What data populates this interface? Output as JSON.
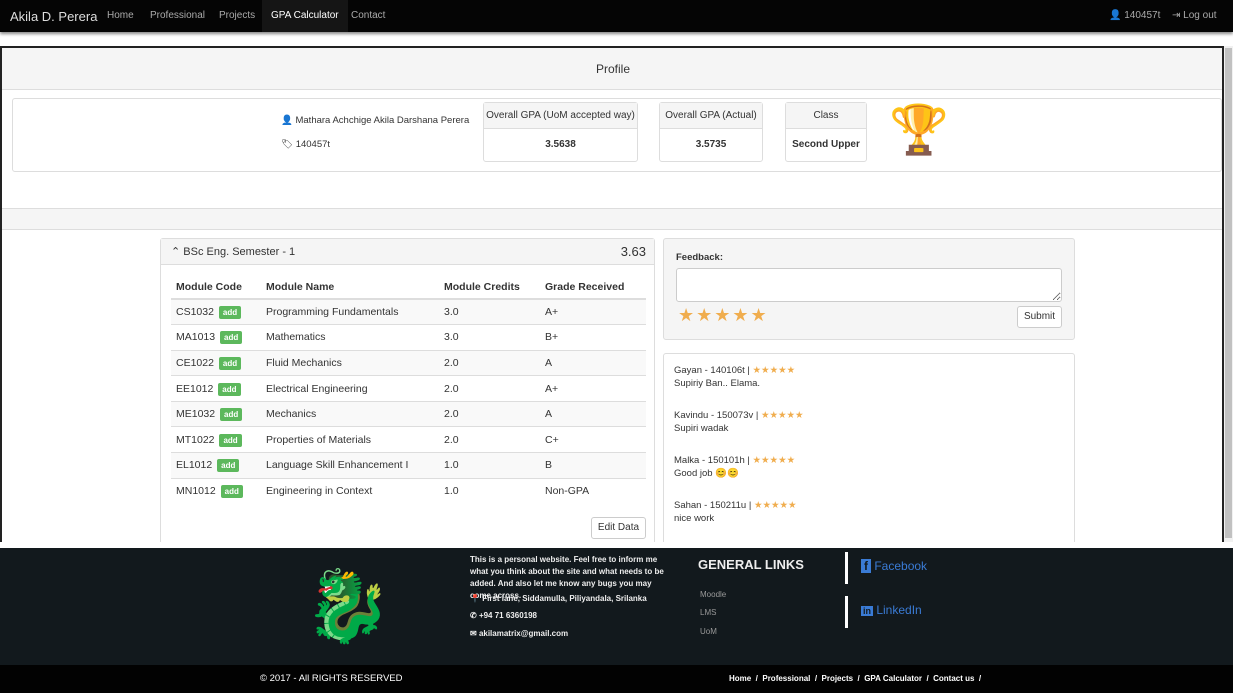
{
  "nav": {
    "brand": "Akila D. Perera",
    "items": [
      "Home",
      "Professional",
      "Projects",
      "GPA Calculator",
      "Contact"
    ],
    "user": "140457t",
    "logout": "Log out"
  },
  "profile": {
    "title": "Profile",
    "name": "Mathara Achchige Akila Darshana Perera",
    "id": "140457t",
    "stats": [
      {
        "label": "Overall GPA (UoM accepted way)",
        "value": "3.5638"
      },
      {
        "label": "Overall GPA (Actual)",
        "value": "3.5735"
      },
      {
        "label": "Class",
        "value": "Second Upper"
      }
    ]
  },
  "semester": {
    "title": "BSc Eng. Semester - 1",
    "gpa": "3.63",
    "headers": [
      "Module Code",
      "Module Name",
      "Module Credits",
      "Grade Received"
    ],
    "add_label": "add",
    "edit_label": "Edit Data",
    "rows": [
      [
        "CS1032",
        "Programming Fundamentals",
        "3.0",
        "A+"
      ],
      [
        "MA1013",
        "Mathematics",
        "3.0",
        "B+"
      ],
      [
        "CE1022",
        "Fluid Mechanics",
        "2.0",
        "A"
      ],
      [
        "EE1012",
        "Electrical Engineering",
        "2.0",
        "A+"
      ],
      [
        "ME1032",
        "Mechanics",
        "2.0",
        "A"
      ],
      [
        "MT1022",
        "Properties of Materials",
        "2.0",
        "C+"
      ],
      [
        "EL1012",
        "Language Skill Enhancement I",
        "1.0",
        "B"
      ],
      [
        "MN1012",
        "Engineering in Context",
        "1.0",
        "Non-GPA"
      ]
    ]
  },
  "feedback": {
    "label": "Feedback:",
    "value": "",
    "rating": 5,
    "submit": "Submit"
  },
  "reviews": [
    {
      "author": "Gayan - 140106t |",
      "text": "Supiriy Ban.. Elama.",
      "rating": 5
    },
    {
      "author": "Kavindu - 150073v |",
      "text": "Supiri wadak",
      "rating": 5
    },
    {
      "author": "Malka - 150101h |",
      "text": "Good job 😊😊",
      "rating": 5
    },
    {
      "author": "Sahan - 150211u |",
      "text": "nice work",
      "rating": 5
    }
  ],
  "footer": {
    "about": "This is a personal website. Feel free to inform me what you think about the site and what needs to be added. And also let me know any bugs you may come across.",
    "address": "First lane, Siddamulla, Piliyandala, Srilanka",
    "phone": "+94 71 6360198",
    "email": "akilamatrix@gmail.com",
    "links_title": "GENERAL LINKS",
    "links": [
      "Moodle",
      "LMS",
      "UoM"
    ],
    "facebook": "Facebook",
    "linkedin": "LinkedIn",
    "copyright": "© 2017 - All RIGHTS RESERVED",
    "bottom_links": [
      "Home",
      "Professional",
      "Projects",
      "GPA Calculator",
      "Contact us"
    ]
  }
}
